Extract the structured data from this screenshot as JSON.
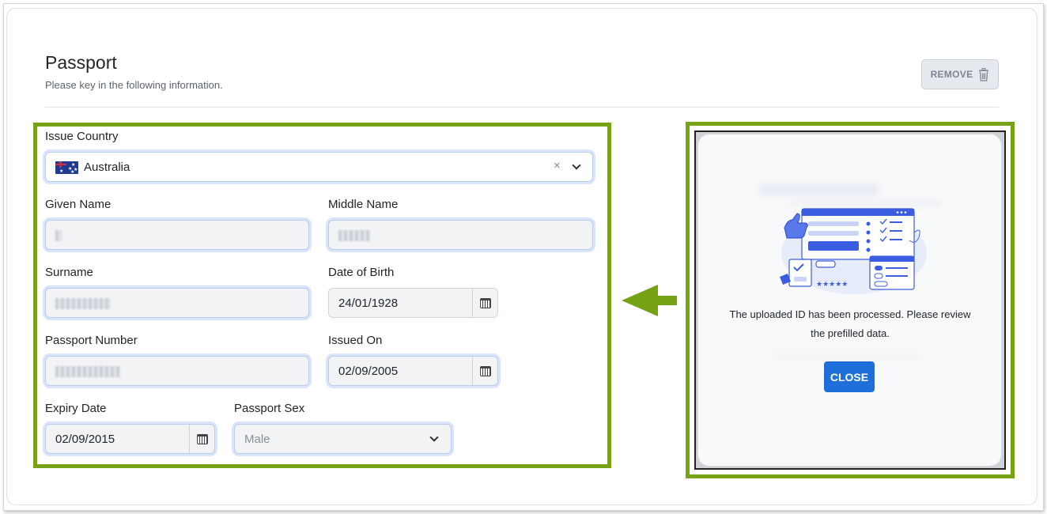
{
  "section": {
    "title": "Passport",
    "subtitle": "Please key in the following information.",
    "remove_label": "REMOVE"
  },
  "form": {
    "issue_country": {
      "label": "Issue Country",
      "value": "Australia"
    },
    "given_name": {
      "label": "Given Name"
    },
    "middle_name": {
      "label": "Middle Name"
    },
    "surname": {
      "label": "Surname"
    },
    "date_of_birth": {
      "label": "Date of Birth",
      "value": "24/01/1928"
    },
    "passport_number": {
      "label": "Passport Number"
    },
    "issued_on": {
      "label": "Issued On",
      "value": "02/09/2005"
    },
    "expiry_date": {
      "label": "Expiry Date",
      "value": "02/09/2015"
    },
    "passport_sex": {
      "label": "Passport Sex",
      "value": "Male"
    }
  },
  "modal": {
    "message_line1": "The uploaded ID has been processed. Please review",
    "message_line2": "the prefilled data.",
    "close_label": "CLOSE"
  },
  "colors": {
    "highlight": "#76a316",
    "primary_button": "#1e6fd9"
  },
  "icons": {
    "remove": "trash-icon",
    "calendar": "calendar-icon",
    "dropdown": "chevron-down-icon",
    "clear": "clear-x-icon",
    "pointer": "arrow-left-icon",
    "flag": "australia-flag-icon"
  }
}
